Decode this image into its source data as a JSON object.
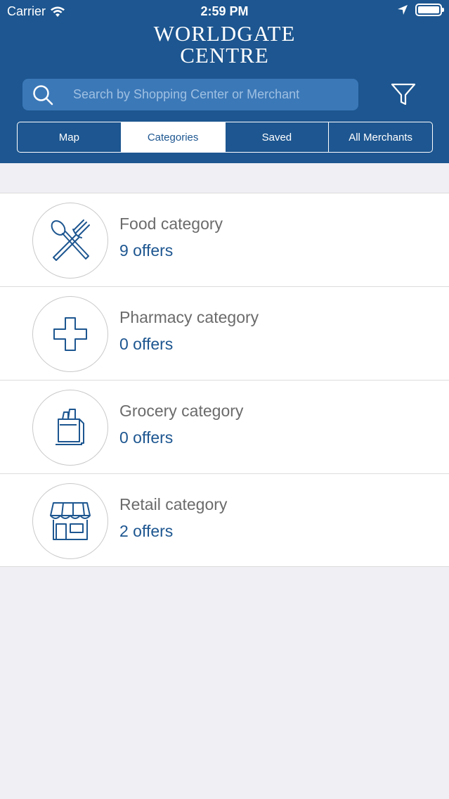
{
  "status_bar": {
    "carrier": "Carrier",
    "time": "2:59 PM"
  },
  "logo": {
    "line1": "WORLDGATE",
    "line2": "CENTRE"
  },
  "search": {
    "placeholder": "Search by Shopping Center or Merchant"
  },
  "tabs": [
    {
      "label": "Map",
      "active": false
    },
    {
      "label": "Categories",
      "active": true
    },
    {
      "label": "Saved",
      "active": false
    },
    {
      "label": "All Merchants",
      "active": false
    }
  ],
  "categories": [
    {
      "title": "Food category",
      "count": "9 offers",
      "icon": "fork-spoon-icon"
    },
    {
      "title": "Pharmacy category",
      "count": "0 offers",
      "icon": "cross-icon"
    },
    {
      "title": "Grocery category",
      "count": "0 offers",
      "icon": "grocery-bag-icon"
    },
    {
      "title": "Retail category",
      "count": "2 offers",
      "icon": "storefront-icon"
    }
  ],
  "colors": {
    "header": "#1d5690",
    "accent": "#1d5690",
    "background": "#efeff4"
  }
}
